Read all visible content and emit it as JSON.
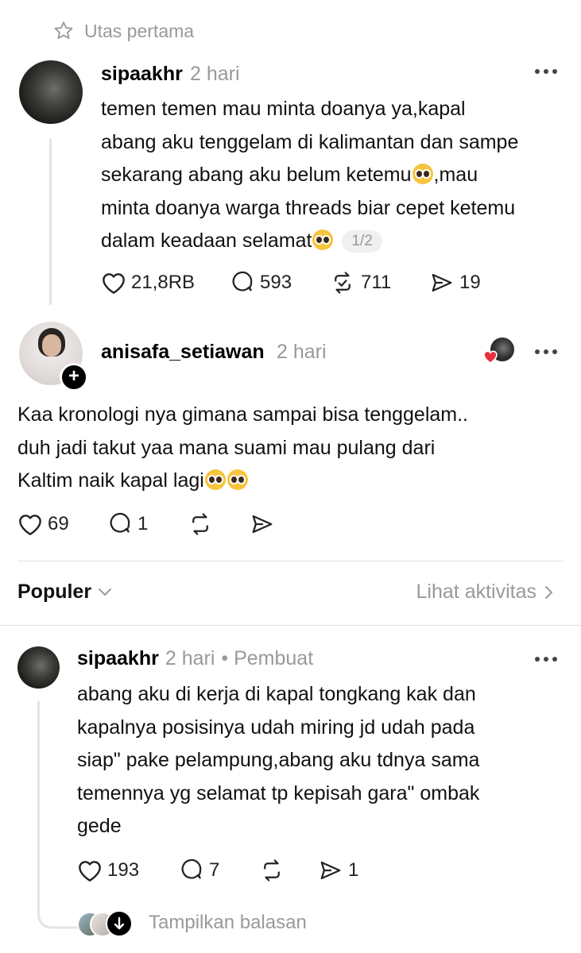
{
  "thread_header": {
    "label": "Utas pertama"
  },
  "post1": {
    "username": "sipaakhr",
    "time": "2 hari",
    "lines": [
      "temen temen mau minta doanya ya,kapal",
      "abang aku tenggelam di kalimantan dan sampe",
      "sekarang abang aku belum ketemu",
      ",mau",
      "minta doanya warga threads biar cepet ketemu",
      "dalam keadaan selamat"
    ],
    "page_indicator": "1/2",
    "likes": "21,8RB",
    "replies": "593",
    "reposts": "711",
    "shares": "19",
    "emoji": "pleading-face"
  },
  "reply1": {
    "username": "anisafa_setiawan",
    "time": "2 hari",
    "lines": [
      "Kaa kronologi nya gimana sampai bisa tenggelam..",
      "duh jadi takut yaa mana suami mau pulang dari",
      "Kaltim naik kapal lagi"
    ],
    "likes": "69",
    "replies": "1",
    "follow_badge": "+"
  },
  "sort_bar": {
    "sort_label": "Populer",
    "activity_label": "Lihat aktivitas"
  },
  "reply2": {
    "username": "sipaakhr",
    "time": "2 hari",
    "role": "• Pembuat",
    "lines": [
      "abang aku di kerja di kapal tongkang kak dan",
      "kapalnya posisinya udah miring jd udah pada",
      "siap\" pake pelampung,abang aku tdnya sama",
      "temennya yg selamat tp kepisah gara\" ombak",
      "gede"
    ],
    "likes": "193",
    "replies": "7",
    "shares": "1",
    "show_replies_label": "Tampilkan balasan"
  },
  "colors": {
    "muted": "#999999",
    "heart_red": "#e8303f",
    "line": "#e4e4e4"
  }
}
